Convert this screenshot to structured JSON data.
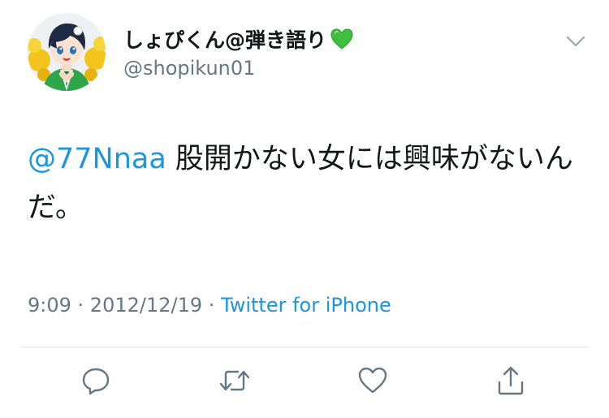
{
  "user": {
    "display_name": "しょぴくん@弾き語り",
    "handle": "@shopikun01",
    "name_emoji": "green-heart-icon",
    "avatar_icon": "anime-boy-avatar"
  },
  "tweet": {
    "mention": "@77Nnaa",
    "text": " 股開かない女には興味がないんだ。"
  },
  "meta": {
    "time": "9:09",
    "separator1": " · ",
    "date": "2012/12/19",
    "separator2": " · ",
    "source": "Twitter for iPhone"
  },
  "actions": {
    "reply_icon": "reply-icon",
    "retweet_icon": "retweet-icon",
    "like_icon": "like-icon",
    "share_icon": "share-icon",
    "more_icon": "chevron-down-icon"
  },
  "colors": {
    "link": "#1b95e0",
    "secondary": "#657786",
    "primary_text": "#14171a",
    "divider": "#e1e8ed",
    "icon": "#657786",
    "emoji_heart": "#3fbf3f"
  }
}
